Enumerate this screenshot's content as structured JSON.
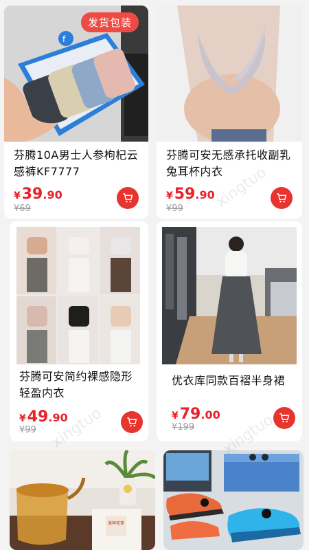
{
  "watermark": "xingtuo",
  "products": [
    {
      "title": "芬腾10A男士人参枸杞云感裤KF7777",
      "currency": "¥",
      "price_int": "39",
      "price_dec": ".90",
      "original_price": "¥69",
      "badge": "发货包装"
    },
    {
      "title": "芬腾可安无感承托收副乳兔耳杯内衣",
      "currency": "¥",
      "price_int": "59",
      "price_dec": ".90",
      "original_price": "¥99"
    },
    {
      "title": "芬腾可安简约裸感隐形轻盈内衣",
      "currency": "¥",
      "price_int": "49",
      "price_dec": ".90",
      "original_price": "¥99"
    },
    {
      "title": "优衣库同款百褶半身裙",
      "currency": "¥",
      "price_int": "79",
      "price_dec": ".00",
      "original_price": "¥199"
    },
    {
      "title": "",
      "currency": "",
      "price_int": "",
      "price_dec": "",
      "original_price": ""
    },
    {
      "title": "",
      "currency": "",
      "price_int": "",
      "price_dec": "",
      "original_price": ""
    }
  ],
  "tea_label": "洛神花茶"
}
